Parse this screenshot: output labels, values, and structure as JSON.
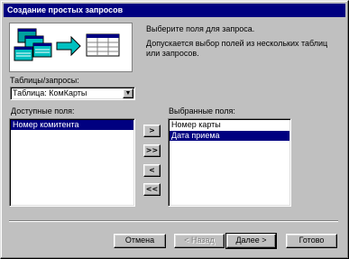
{
  "window": {
    "title": "Создание простых запросов"
  },
  "intro": {
    "line1": "Выберите поля для запроса.",
    "line2": "Допускается выбор полей из нескольких таблиц",
    "line3": "или запросов."
  },
  "tables": {
    "label": "Таблицы/запросы:",
    "selected": "Таблица: КомКарты"
  },
  "available_fields": {
    "label": "Доступные поля:",
    "items": [
      "Номер комитента"
    ]
  },
  "selected_fields": {
    "label": "Выбранные поля:",
    "items": [
      "Номер карты",
      "Дата приема"
    ]
  },
  "move_buttons": {
    "add_one": ">",
    "add_all": ">>",
    "remove_one": "<",
    "remove_all": "<<"
  },
  "footer": {
    "cancel": "Отмена",
    "back": "< Назад",
    "next": "Далее >",
    "finish": "Готово"
  }
}
